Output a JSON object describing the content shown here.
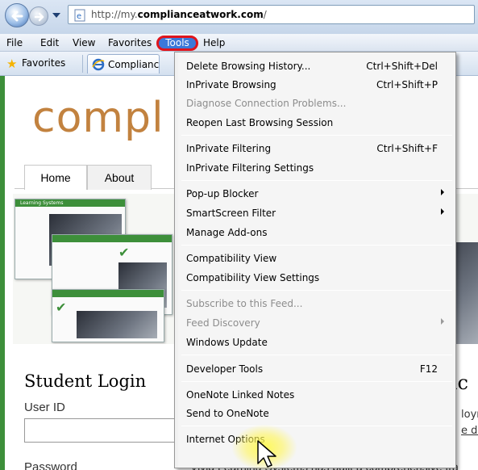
{
  "browser": {
    "url_prefix": "http://my.",
    "url_domain": "complianceatwork.com",
    "url_suffix": "/"
  },
  "menubar": {
    "items": [
      "File",
      "Edit",
      "View",
      "Favorites",
      "Tools",
      "Help"
    ]
  },
  "favorites_bar": {
    "favorites_label": "Favorites",
    "tab_title": "Complianc"
  },
  "page": {
    "logo_text": "compl",
    "nav_tabs": [
      "Home",
      "About"
    ],
    "student_login": "Student Login",
    "user_id_label": "User ID",
    "password_label": "Password",
    "right_heading": "nc",
    "right_line1": "loym",
    "right_line2": "e de",
    "bottom_text": "Vivid Learning Systems has built a comprehensive tra",
    "banner_caption": "Learning Systems"
  },
  "tools_menu": {
    "items": [
      {
        "label": "Delete Browsing History...",
        "shortcut": "Ctrl+Shift+Del",
        "disabled": false
      },
      {
        "label": "InPrivate Browsing",
        "shortcut": "Ctrl+Shift+P",
        "disabled": false
      },
      {
        "label": "Diagnose Connection Problems...",
        "shortcut": "",
        "disabled": true
      },
      {
        "label": "Reopen Last Browsing Session",
        "shortcut": "",
        "disabled": false
      },
      {
        "label": "InPrivate Filtering",
        "shortcut": "Ctrl+Shift+F",
        "disabled": false
      },
      {
        "label": "InPrivate Filtering Settings",
        "shortcut": "",
        "disabled": false
      },
      {
        "label": "Pop-up Blocker",
        "shortcut": "",
        "disabled": false,
        "submenu": true
      },
      {
        "label": "SmartScreen Filter",
        "shortcut": "",
        "disabled": false,
        "submenu": true
      },
      {
        "label": "Manage Add-ons",
        "shortcut": "",
        "disabled": false
      },
      {
        "label": "Compatibility View",
        "shortcut": "",
        "disabled": false
      },
      {
        "label": "Compatibility View Settings",
        "shortcut": "",
        "disabled": false
      },
      {
        "label": "Subscribe to this Feed...",
        "shortcut": "",
        "disabled": true
      },
      {
        "label": "Feed Discovery",
        "shortcut": "",
        "disabled": true,
        "submenu": true
      },
      {
        "label": "Windows Update",
        "shortcut": "",
        "disabled": false
      },
      {
        "label": "Developer Tools",
        "shortcut": "F12",
        "disabled": false
      },
      {
        "label": "OneNote Linked Notes",
        "shortcut": "",
        "disabled": false
      },
      {
        "label": "Send to OneNote",
        "shortcut": "",
        "disabled": false
      },
      {
        "label": "Internet Options",
        "shortcut": "",
        "disabled": false,
        "highlighted": true
      }
    ]
  },
  "colors": {
    "highlight_ring": "#e0141c",
    "menu_selected": "#3b78d8",
    "logo": "#c2823f",
    "brand_green": "#3d8f3a"
  }
}
